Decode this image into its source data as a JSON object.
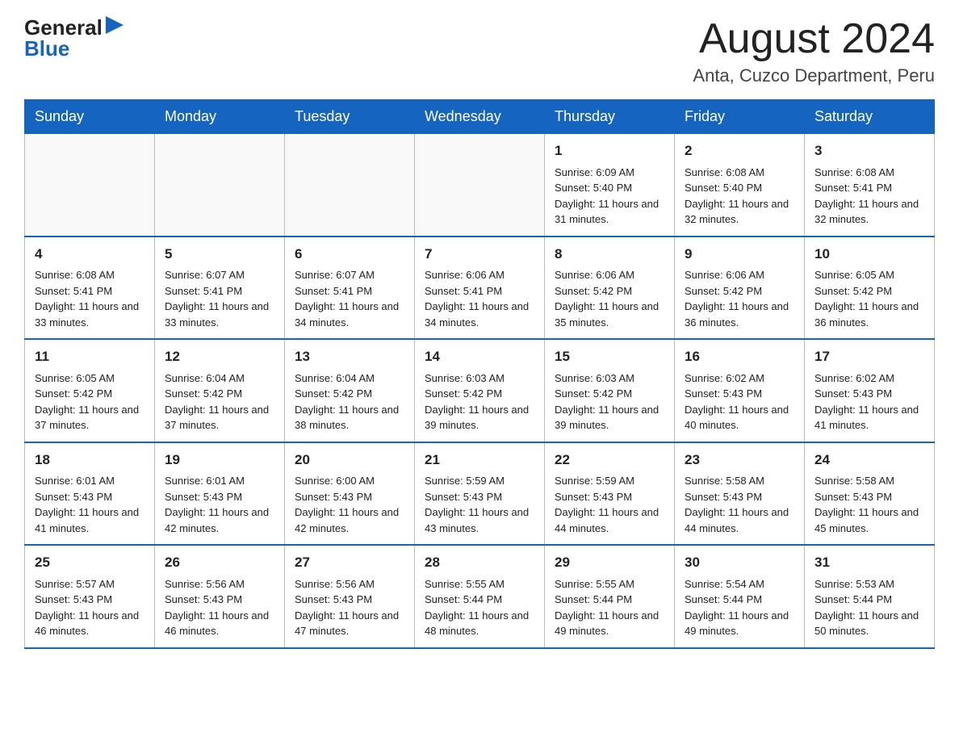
{
  "header": {
    "logo_general": "General",
    "logo_blue": "Blue",
    "month_title": "August 2024",
    "location": "Anta, Cuzco Department, Peru"
  },
  "weekdays": [
    "Sunday",
    "Monday",
    "Tuesday",
    "Wednesday",
    "Thursday",
    "Friday",
    "Saturday"
  ],
  "weeks": [
    [
      {
        "day": "",
        "info": ""
      },
      {
        "day": "",
        "info": ""
      },
      {
        "day": "",
        "info": ""
      },
      {
        "day": "",
        "info": ""
      },
      {
        "day": "1",
        "info": "Sunrise: 6:09 AM\nSunset: 5:40 PM\nDaylight: 11 hours and 31 minutes."
      },
      {
        "day": "2",
        "info": "Sunrise: 6:08 AM\nSunset: 5:40 PM\nDaylight: 11 hours and 32 minutes."
      },
      {
        "day": "3",
        "info": "Sunrise: 6:08 AM\nSunset: 5:41 PM\nDaylight: 11 hours and 32 minutes."
      }
    ],
    [
      {
        "day": "4",
        "info": "Sunrise: 6:08 AM\nSunset: 5:41 PM\nDaylight: 11 hours and 33 minutes."
      },
      {
        "day": "5",
        "info": "Sunrise: 6:07 AM\nSunset: 5:41 PM\nDaylight: 11 hours and 33 minutes."
      },
      {
        "day": "6",
        "info": "Sunrise: 6:07 AM\nSunset: 5:41 PM\nDaylight: 11 hours and 34 minutes."
      },
      {
        "day": "7",
        "info": "Sunrise: 6:06 AM\nSunset: 5:41 PM\nDaylight: 11 hours and 34 minutes."
      },
      {
        "day": "8",
        "info": "Sunrise: 6:06 AM\nSunset: 5:42 PM\nDaylight: 11 hours and 35 minutes."
      },
      {
        "day": "9",
        "info": "Sunrise: 6:06 AM\nSunset: 5:42 PM\nDaylight: 11 hours and 36 minutes."
      },
      {
        "day": "10",
        "info": "Sunrise: 6:05 AM\nSunset: 5:42 PM\nDaylight: 11 hours and 36 minutes."
      }
    ],
    [
      {
        "day": "11",
        "info": "Sunrise: 6:05 AM\nSunset: 5:42 PM\nDaylight: 11 hours and 37 minutes."
      },
      {
        "day": "12",
        "info": "Sunrise: 6:04 AM\nSunset: 5:42 PM\nDaylight: 11 hours and 37 minutes."
      },
      {
        "day": "13",
        "info": "Sunrise: 6:04 AM\nSunset: 5:42 PM\nDaylight: 11 hours and 38 minutes."
      },
      {
        "day": "14",
        "info": "Sunrise: 6:03 AM\nSunset: 5:42 PM\nDaylight: 11 hours and 39 minutes."
      },
      {
        "day": "15",
        "info": "Sunrise: 6:03 AM\nSunset: 5:42 PM\nDaylight: 11 hours and 39 minutes."
      },
      {
        "day": "16",
        "info": "Sunrise: 6:02 AM\nSunset: 5:43 PM\nDaylight: 11 hours and 40 minutes."
      },
      {
        "day": "17",
        "info": "Sunrise: 6:02 AM\nSunset: 5:43 PM\nDaylight: 11 hours and 41 minutes."
      }
    ],
    [
      {
        "day": "18",
        "info": "Sunrise: 6:01 AM\nSunset: 5:43 PM\nDaylight: 11 hours and 41 minutes."
      },
      {
        "day": "19",
        "info": "Sunrise: 6:01 AM\nSunset: 5:43 PM\nDaylight: 11 hours and 42 minutes."
      },
      {
        "day": "20",
        "info": "Sunrise: 6:00 AM\nSunset: 5:43 PM\nDaylight: 11 hours and 42 minutes."
      },
      {
        "day": "21",
        "info": "Sunrise: 5:59 AM\nSunset: 5:43 PM\nDaylight: 11 hours and 43 minutes."
      },
      {
        "day": "22",
        "info": "Sunrise: 5:59 AM\nSunset: 5:43 PM\nDaylight: 11 hours and 44 minutes."
      },
      {
        "day": "23",
        "info": "Sunrise: 5:58 AM\nSunset: 5:43 PM\nDaylight: 11 hours and 44 minutes."
      },
      {
        "day": "24",
        "info": "Sunrise: 5:58 AM\nSunset: 5:43 PM\nDaylight: 11 hours and 45 minutes."
      }
    ],
    [
      {
        "day": "25",
        "info": "Sunrise: 5:57 AM\nSunset: 5:43 PM\nDaylight: 11 hours and 46 minutes."
      },
      {
        "day": "26",
        "info": "Sunrise: 5:56 AM\nSunset: 5:43 PM\nDaylight: 11 hours and 46 minutes."
      },
      {
        "day": "27",
        "info": "Sunrise: 5:56 AM\nSunset: 5:43 PM\nDaylight: 11 hours and 47 minutes."
      },
      {
        "day": "28",
        "info": "Sunrise: 5:55 AM\nSunset: 5:44 PM\nDaylight: 11 hours and 48 minutes."
      },
      {
        "day": "29",
        "info": "Sunrise: 5:55 AM\nSunset: 5:44 PM\nDaylight: 11 hours and 49 minutes."
      },
      {
        "day": "30",
        "info": "Sunrise: 5:54 AM\nSunset: 5:44 PM\nDaylight: 11 hours and 49 minutes."
      },
      {
        "day": "31",
        "info": "Sunrise: 5:53 AM\nSunset: 5:44 PM\nDaylight: 11 hours and 50 minutes."
      }
    ]
  ]
}
